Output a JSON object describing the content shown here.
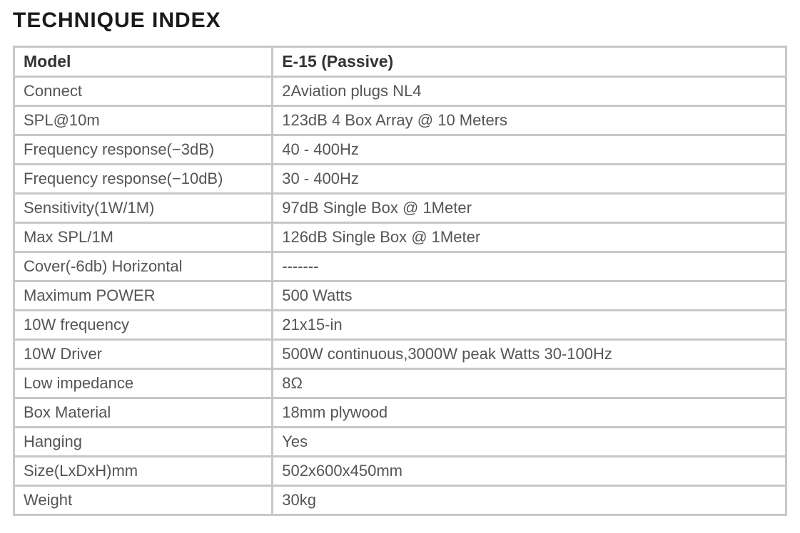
{
  "title": "TECHNIQUE INDEX",
  "header": {
    "label": "Model",
    "value": "E-15 (Passive)"
  },
  "rows": [
    {
      "label": "Connect",
      "value": "2Aviation plugs NL4"
    },
    {
      "label": "SPL@10m",
      "value": "123dB 4 Box Array @ 10 Meters"
    },
    {
      "label": "Frequency response(−3dB)",
      "value": "40 - 400Hz"
    },
    {
      "label": "Frequency response(−10dB)",
      "value": "30 - 400Hz"
    },
    {
      "label": "Sensitivity(1W/1M)",
      "value": "97dB Single Box @ 1Meter"
    },
    {
      "label": "Max SPL/1M",
      "value": "126dB Single Box @ 1Meter"
    },
    {
      "label": "Cover(-6db) Horizontal",
      "value": "-------"
    },
    {
      "label": "Maximum POWER",
      "value": "500 Watts"
    },
    {
      "label": "10W frequency",
      "value": "21x15-in"
    },
    {
      "label": "10W Driver",
      "value": "500W continuous,3000W peak Watts 30-100Hz"
    },
    {
      "label": "Low impedance",
      "value": "8Ω"
    },
    {
      "label": "Box Material",
      "value": "18mm plywood"
    },
    {
      "label": "Hanging",
      "value": "Yes"
    },
    {
      "label": "Size(LxDxH)mm",
      "value": "502x600x450mm"
    },
    {
      "label": "Weight",
      "value": "30kg"
    }
  ]
}
